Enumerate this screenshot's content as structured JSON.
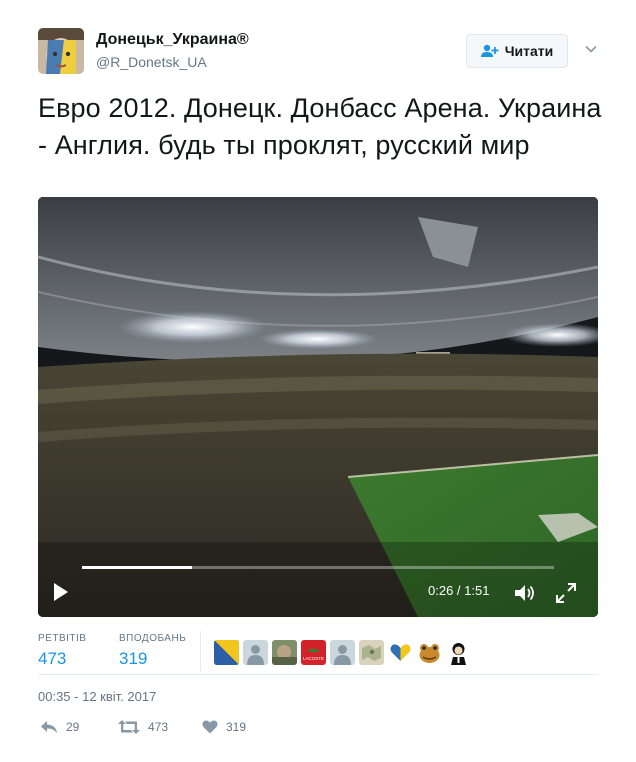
{
  "user": {
    "display_name": "Донецьк_Украина®",
    "handle": "@R_Donetsk_UA"
  },
  "follow_button": {
    "label": "Читати"
  },
  "tweet": {
    "text": "Евро 2012. Донецк. Донбасс Арена. Украина - Англия. будь ты проклят, русский мир",
    "timestamp": "00:35 - 12 квіт. 2017"
  },
  "video": {
    "time_display": "0:26 / 1:51",
    "progress": 0.234
  },
  "stats": {
    "retweets_label": "РЕТВІТІВ",
    "retweets_value": "473",
    "likes_label": "ВПОДОБАНЬ",
    "likes_value": "319"
  },
  "likers": [
    "avatar-flag",
    "avatar-default",
    "avatar-photo",
    "avatar-lacoste",
    "avatar-default",
    "avatar-map",
    "avatar-heart-ua",
    "avatar-frog",
    "avatar-cartoon"
  ],
  "likers_lacoste_text": "LACOSTE",
  "actions": {
    "reply_count": "29",
    "retweet_count": "473",
    "like_count": "319"
  },
  "colors": {
    "link_blue": "#1b95e0",
    "muted": "#657786",
    "text": "#14171a"
  }
}
